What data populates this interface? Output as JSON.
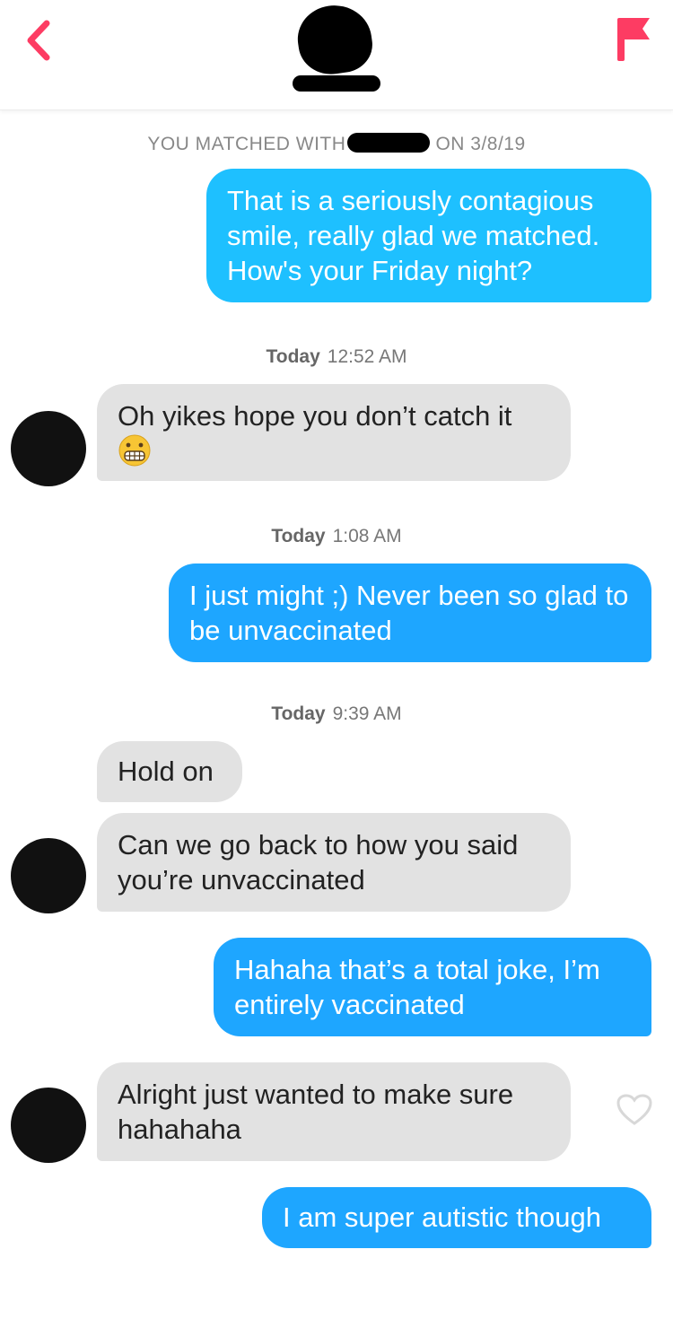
{
  "header": {
    "back_icon": "chevron-left-icon",
    "report_icon": "flag-icon",
    "accent": "#fd3c63"
  },
  "match_info": {
    "prefix": "YOU MATCHED WITH",
    "suffix": "ON 3/8/19"
  },
  "messages": [
    {
      "type": "sent",
      "text": "That is a seriously contagious smile, really glad we matched. How's your Friday night?"
    },
    {
      "type": "timestamp",
      "day": "Today",
      "time": "12:52 AM"
    },
    {
      "type": "received",
      "text": "Oh yikes hope you don’t catch it",
      "emoji": "grimacing-face"
    },
    {
      "type": "timestamp",
      "day": "Today",
      "time": "1:08 AM"
    },
    {
      "type": "sent",
      "text": "I just might ;) Never been so glad to be unvaccinated"
    },
    {
      "type": "timestamp",
      "day": "Today",
      "time": "9:39 AM"
    },
    {
      "type": "received",
      "text": "Hold on"
    },
    {
      "type": "received",
      "text": "Can we go back to how you said you’re unvaccinated"
    },
    {
      "type": "sent",
      "text": "Hahaha that’s a total joke, I’m entirely vaccinated"
    },
    {
      "type": "received",
      "text": "Alright just wanted to make sure hahahaha"
    },
    {
      "type": "sent",
      "text": "I am super autistic though"
    }
  ],
  "colors": {
    "sent_bubble": "#1ea6ff",
    "received_bubble": "#e2e2e2"
  }
}
